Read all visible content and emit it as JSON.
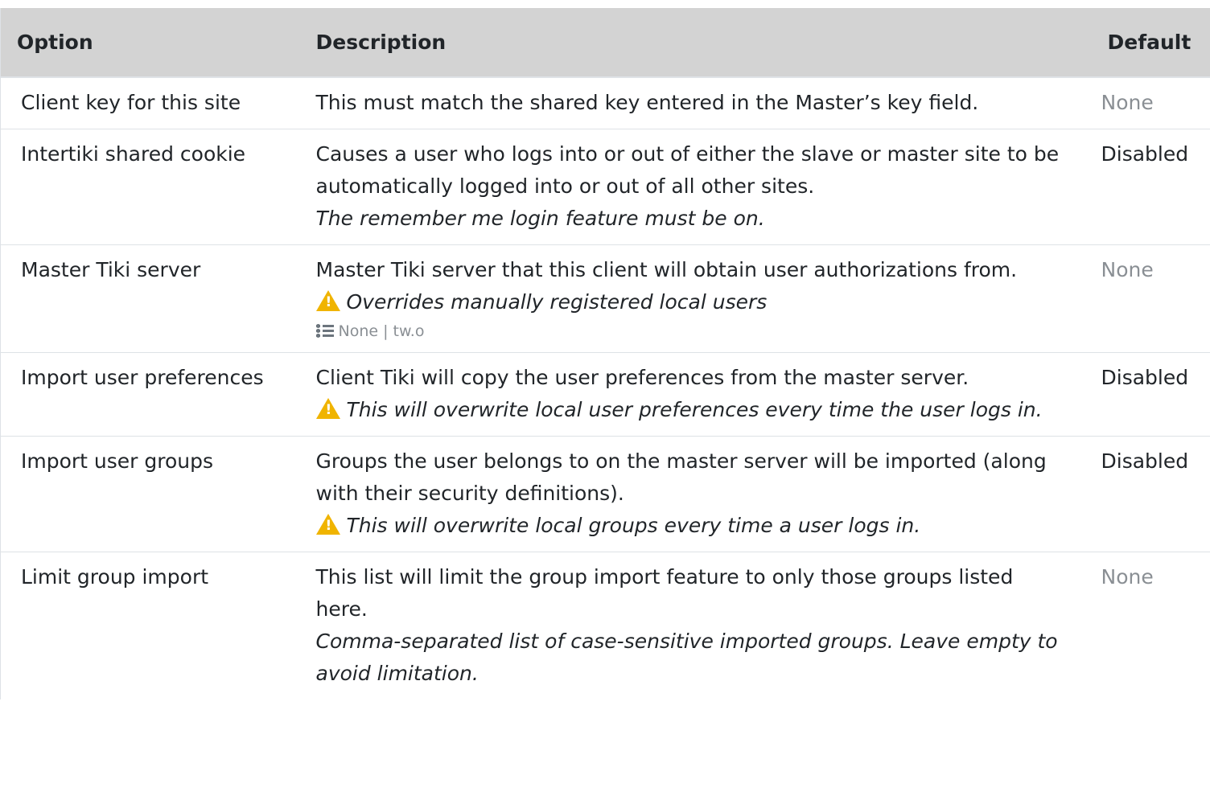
{
  "header": {
    "option": "Option",
    "description": "Description",
    "default": "Default"
  },
  "rows": [
    {
      "option": "Client key for this site",
      "description": "This must match the shared key entered in the Master’s key field.",
      "default": "None"
    },
    {
      "option": "Intertiki shared cookie",
      "description": "Causes a user who logs into or out of either the slave or master site to be automatically logged into or out of all other sites.",
      "note": "The remember me login feature must be on.",
      "default": "Disabled"
    },
    {
      "option": "Master Tiki server",
      "description": "Master Tiki server that this client will obtain user authorizations from.",
      "warning": "Overrides manually registered local users",
      "tags": "None | tw.o",
      "default": "None"
    },
    {
      "option": "Import user preferences",
      "description": "Client Tiki will copy the user preferences from the master server.",
      "warning": "This will overwrite local user preferences every time the user logs in.",
      "default": "Disabled"
    },
    {
      "option": "Import user groups",
      "description": "Groups the user belongs to on the master server will be imported (along with their security definitions).",
      "warning": "This will overwrite local groups every time a user logs in.",
      "default": "Disabled"
    },
    {
      "option": "Limit group import",
      "description": "This list will limit the group import feature to only those groups listed here.",
      "note": "Comma-separated list of case-sensitive imported groups. Leave empty to avoid limitation.",
      "default": "None"
    }
  ],
  "colors": {
    "header_bg": "#d3d3d3",
    "muted_default": "#8a8f94",
    "warning": "#f0b400",
    "border": "#dee2e6"
  },
  "icons": {
    "warning": "warning-triangle-icon",
    "tags": "list-icon"
  }
}
